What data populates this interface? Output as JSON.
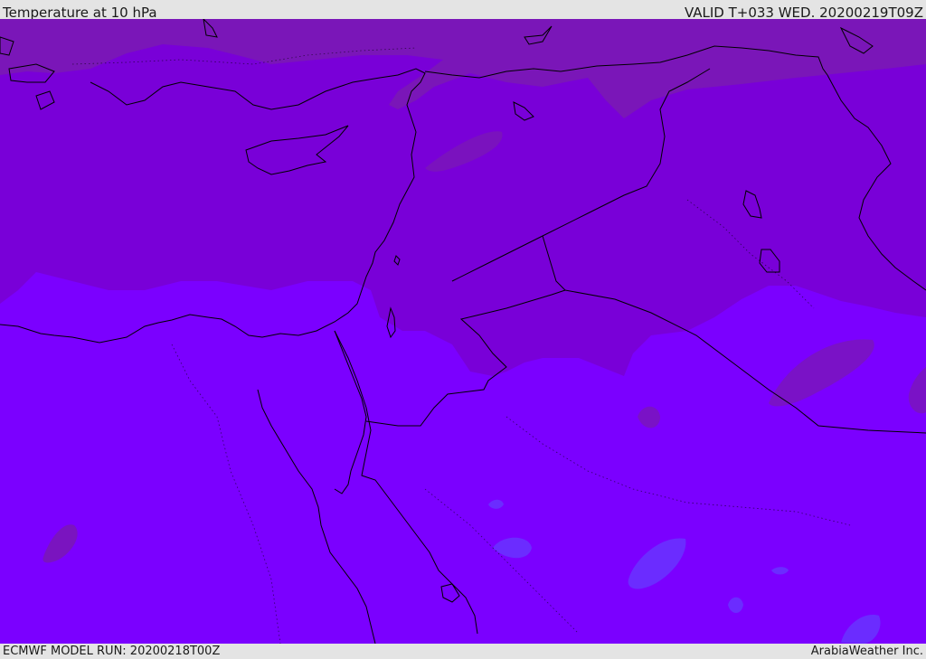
{
  "header": {
    "title": "Temperature at 10 hPa",
    "valid": "VALID T+033 WED. 20200219T09Z"
  },
  "footer": {
    "model_run": "ECMWF MODEL RUN: 20200218T00Z",
    "credit": "ArabiaWeather Inc."
  },
  "colors": {
    "field_base": "#7b00ff",
    "field_cold": "#7900d8",
    "field_colder": "#7a16b8",
    "field_warm": "#6b2cff",
    "coast": "#000000",
    "bar_bg": "#e4e4e4"
  }
}
